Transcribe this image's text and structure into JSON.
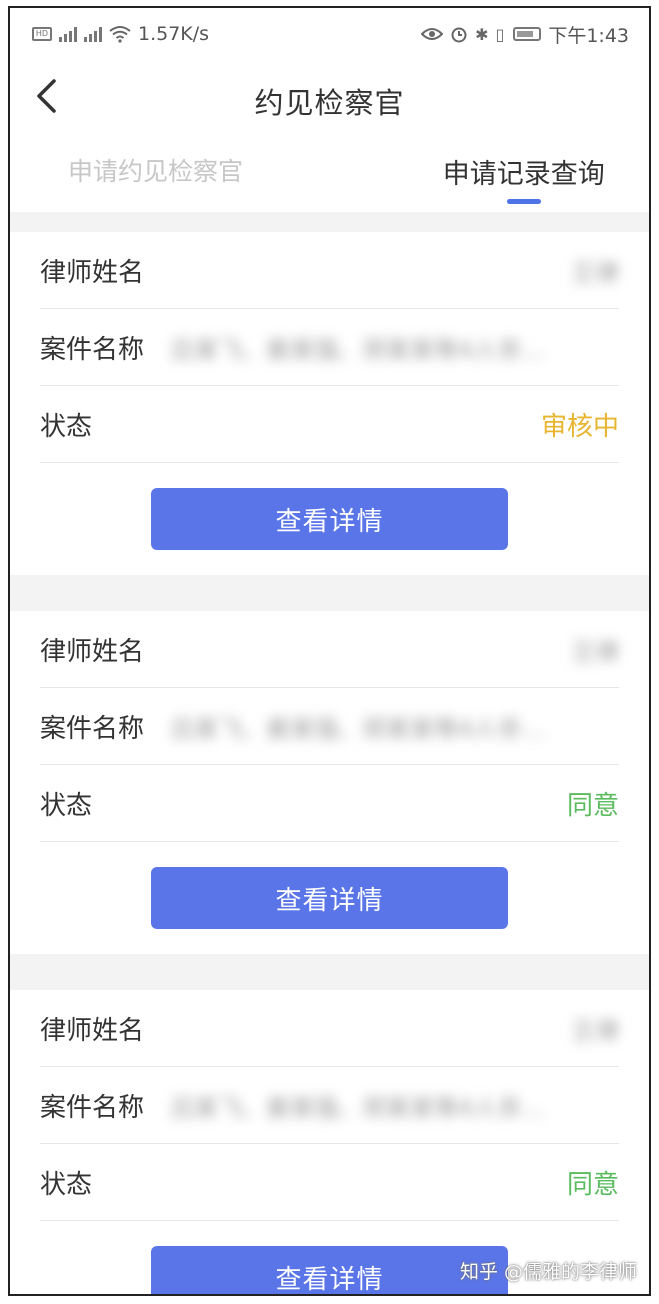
{
  "statusbar": {
    "network_speed": "1.57K/s",
    "time": "下午1:43"
  },
  "header": {
    "title": "约见检察官"
  },
  "tabs": [
    {
      "label": "申请约见检察官",
      "active": false
    },
    {
      "label": "申请记录查询",
      "active": true
    }
  ],
  "records": [
    {
      "lawyer_key": "律师姓名",
      "lawyer_value": "王律",
      "case_key": "案件名称",
      "case_value": "吕某飞、姜某强、郑某某等4人非…",
      "status_key": "状态",
      "status_value": "审核中",
      "status_color": "#e8b531",
      "button": "查看详情"
    },
    {
      "lawyer_key": "律师姓名",
      "lawyer_value": "王律",
      "case_key": "案件名称",
      "case_value": "吕某飞、姜某强、郑某某等4人非…",
      "status_key": "状态",
      "status_value": "同意",
      "status_color": "#5bbb5f",
      "button": "查看详情"
    },
    {
      "lawyer_key": "律师姓名",
      "lawyer_value": "王律",
      "case_key": "案件名称",
      "case_value": "吕某飞、姜某强、郑某某等4人非…",
      "status_key": "状态",
      "status_value": "同意",
      "status_color": "#5bbb5f",
      "button": "查看详情"
    }
  ],
  "watermark": "知乎 @儒雅的李律师",
  "colors": {
    "accent": "#5a75e8",
    "pending": "#e8b531",
    "approved": "#5bbb5f"
  }
}
